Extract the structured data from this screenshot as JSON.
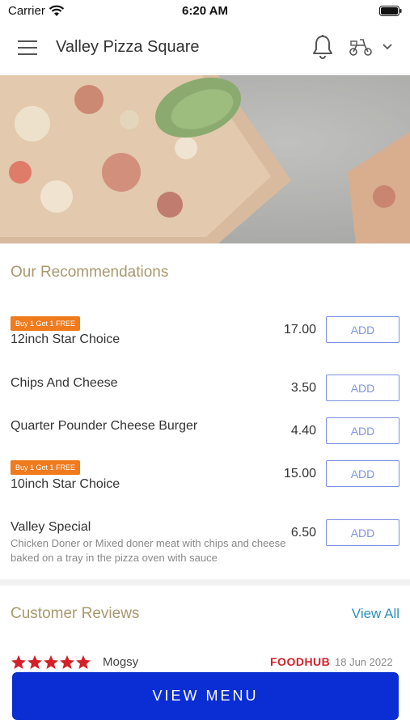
{
  "status_bar": {
    "carrier": "Carrier",
    "time": "6:20 AM"
  },
  "header": {
    "title": "Valley Pizza Square",
    "icons": [
      "menu-icon",
      "bell-icon",
      "scooter-icon",
      "chevron-down-icon"
    ]
  },
  "recommendations": {
    "title": "Our Recommendations",
    "add_label": "ADD",
    "items": [
      {
        "badge": "Buy 1 Get 1 FREE",
        "name": "12inch Star Choice",
        "price": "17.00"
      },
      {
        "name": "Chips And Cheese",
        "price": "3.50"
      },
      {
        "name": "Quarter Pounder Cheese Burger",
        "price": "4.40"
      },
      {
        "badge": "Buy 1 Get 1 FREE",
        "name": "10inch Star Choice",
        "price": "15.00"
      },
      {
        "name": "Valley Special",
        "description": "Chicken Doner or Mixed doner meat with chips and cheese baked on a tray in the pizza oven with sauce",
        "price": "6.50"
      }
    ]
  },
  "reviews": {
    "title": "Customer Reviews",
    "view_all": "View All",
    "first_review": {
      "rating": 5,
      "reviewer": "Mogsy",
      "source": "FOODHUB",
      "date": "18 Jun 2022"
    }
  },
  "cta": {
    "label": "VIEW MENU"
  },
  "colors": {
    "accent": "#0a2ed3",
    "promo": "#f07a1c",
    "section_title": "#a8996e",
    "link": "#2a8fbd",
    "stars": "#d3212a"
  }
}
